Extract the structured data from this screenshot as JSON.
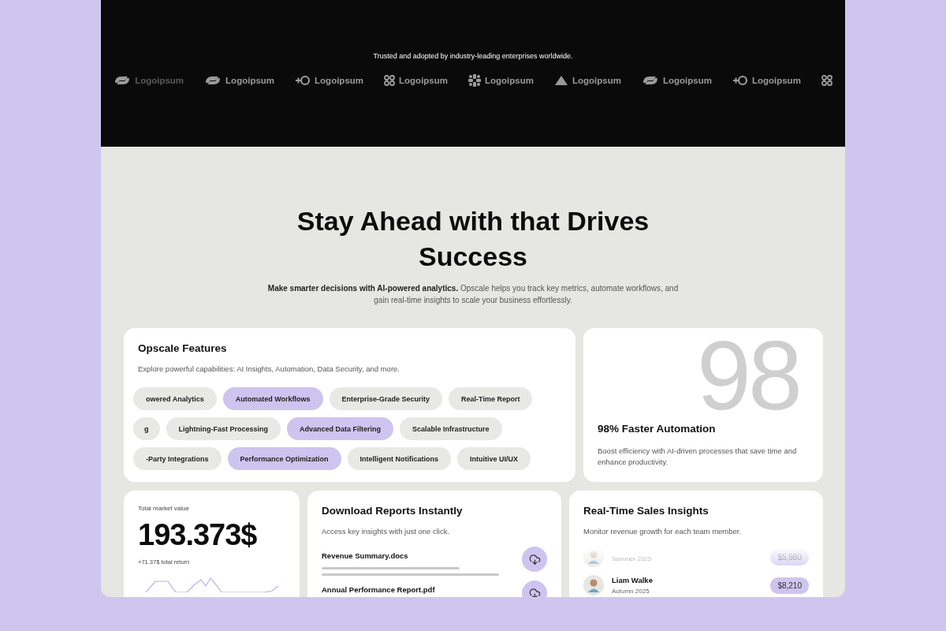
{
  "hero": {
    "tagline": "Trusted and adopted by industry-leading enterprises worldwide.",
    "logos": [
      {
        "kind": "link",
        "name": "Logoipsum"
      },
      {
        "kind": "link",
        "name": "Logoipsum"
      },
      {
        "kind": "plus",
        "name": "Logoipsum"
      },
      {
        "kind": "clover",
        "name": "Logoipsum"
      },
      {
        "kind": "burst",
        "name": "Logoipsum"
      },
      {
        "kind": "mountain",
        "name": "Logoipsum"
      },
      {
        "kind": "link",
        "name": "Logoipsum"
      },
      {
        "kind": "plus",
        "name": "Logoipsum"
      },
      {
        "kind": "clover"
      }
    ]
  },
  "intro": {
    "heading": "Stay Ahead with that Drives Success",
    "lead": "**Make smarter decisions with AI-powered analytics.** Opscale helps you track key metrics, automate workflows, and gain real-time insights to scale your business effortlessly."
  },
  "features": {
    "title": "Opscale Features",
    "description": "Explore powerful capabilities: AI Insights, Automation, Data Security, and more.",
    "rows": [
      [
        {
          "label": "owered Analytics",
          "highlighted": false
        },
        {
          "label": "Automated Workflows",
          "highlighted": true
        },
        {
          "label": "Enterprise-Grade Security",
          "highlighted": false
        },
        {
          "label": "Real-Time Report",
          "highlighted": false
        }
      ],
      [
        {
          "label": "g",
          "highlighted": false
        },
        {
          "label": "Lightning-Fast Processing",
          "highlighted": false
        },
        {
          "label": "Advanced Data Filtering",
          "highlighted": true
        },
        {
          "label": "Scalable Infrastructure",
          "highlighted": false
        }
      ],
      [
        {
          "label": "-Party Integrations",
          "highlighted": false
        },
        {
          "label": "Performance Optimization",
          "highlighted": true
        },
        {
          "label": "Intelligent Notifications",
          "highlighted": false
        },
        {
          "label": "Intuitive UI/UX",
          "highlighted": false
        }
      ]
    ]
  },
  "automation": {
    "big_number": "98",
    "title": "98% Faster Automation",
    "description": "Boost efficiency with AI-driven processes that save time and enhance productivity."
  },
  "market": {
    "label": "Total market value",
    "value": "193.373$",
    "return": "+71.37$ total return"
  },
  "reports": {
    "title": "Download Reports Instantly",
    "description": "Access key insights with just one click.",
    "files": [
      {
        "name": "Revenue Summary.docs"
      },
      {
        "name": "Annual Performance Report.pdf"
      }
    ]
  },
  "sales": {
    "title": "Real-Time Sales Insights",
    "description": "Monitor revenue growth for each team member.",
    "members": [
      {
        "season": "Summer 2025",
        "amount": "$5,980"
      },
      {
        "name": "Liam Walke",
        "season": "Autumn 2025",
        "amount": "$8,210"
      }
    ]
  }
}
